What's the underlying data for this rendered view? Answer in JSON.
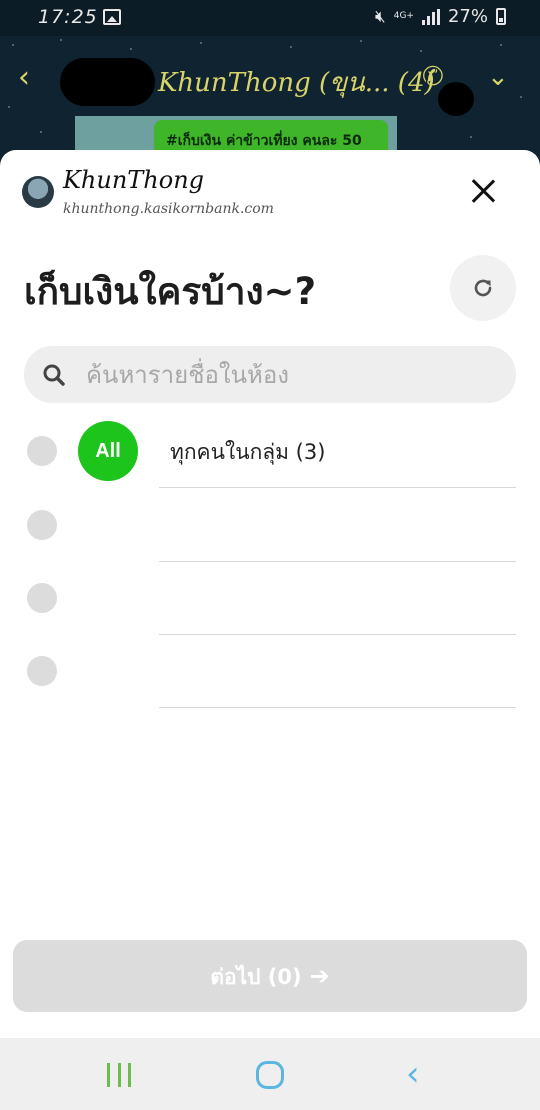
{
  "status_bar": {
    "time": "17:25",
    "network": "4G+",
    "battery": "27%",
    "icons": [
      "gallery-icon",
      "mute-icon",
      "signal-icon",
      "battery-icon"
    ]
  },
  "chat_header": {
    "title": "KhunThong (ขุน... (4)",
    "preview_text": "#เก็บเงิน ค่าข้าวเที่ยง คนละ 50"
  },
  "sheet": {
    "app_name": "KhunThong",
    "app_domain": "khunthong.kasikornbank.com",
    "title": "เก็บเงินใครบ้าง~?",
    "search_placeholder": "ค้นหารายชื่อในห้อง",
    "members": [
      {
        "badge": "All",
        "label": "ทุกคนในกลุ่ม (3)",
        "selected": false
      },
      {
        "label": "",
        "selected": false
      },
      {
        "label": "",
        "selected": false
      },
      {
        "label": "",
        "selected": false
      }
    ],
    "next_label": "ต่อไป (0)",
    "next_arrow": "➔"
  },
  "colors": {
    "accent_green": "#1cc41c",
    "header_text": "#d8d36a",
    "nav_blue": "#5bb6e0",
    "nav_green": "#6cbc52"
  }
}
